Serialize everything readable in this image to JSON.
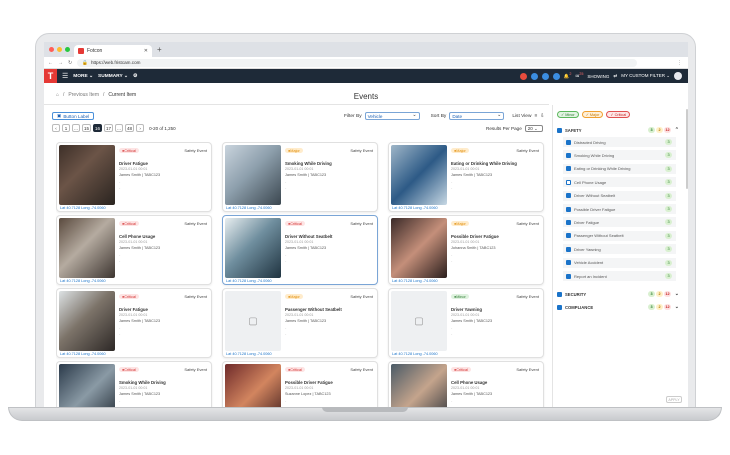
{
  "browser": {
    "tab_title": "Fotcon",
    "url": "https://web.fristcam.com"
  },
  "header": {
    "logo": "T",
    "more_label": "MORE",
    "summary_label": "SUMMARY",
    "showing_label": "SHOWING",
    "filter_label": "MY CUSTOM FILTER",
    "badges": [
      "2",
      "25"
    ]
  },
  "breadcrumb": {
    "previous": "Previous Item",
    "current": "Current Item"
  },
  "page": {
    "title": "Events"
  },
  "toolbar": {
    "button_label": "Button Label",
    "pages": [
      "‹",
      "1",
      "...",
      "15",
      "16",
      "17",
      "...",
      "48",
      "›"
    ],
    "active_page": "16",
    "range": "0-20 of 1,250",
    "filter_by_label": "Filter By",
    "filter_by_value": "Vehicle",
    "sort_by_label": "Sort By",
    "sort_by_value": "Date",
    "list_view_label": "List View",
    "rpp_label": "Results Per Page",
    "rpp_value": "20"
  },
  "events": [
    {
      "severity": "Critical",
      "type": "Safety Event",
      "name": "Driver Fatigue",
      "date": "2023-01-01 00:01",
      "driver": "James Smith | TABC123",
      "loc": "Lat 40.7128 Long -74.0060",
      "photo": "p1"
    },
    {
      "severity": "Major",
      "type": "Safety Event",
      "name": "Smoking While Driving",
      "date": "2023-01-01 00:01",
      "driver": "James Smith | TABC123",
      "loc": "Lat 40.7128 Long -74.0060",
      "photo": "p2"
    },
    {
      "severity": "Major",
      "type": "Safety Event",
      "name": "Eating or Drinking While Driving",
      "date": "2023-01-01 00:01",
      "driver": "James Smith | TABC123",
      "loc": "Lat 40.7128 Long -74.0060",
      "photo": "p3"
    },
    {
      "severity": "Critical",
      "type": "Safety Event",
      "name": "Cell Phone Usage",
      "date": "2023-01-01 00:01",
      "driver": "James Smith | TABC123",
      "loc": "Lat 40.7128 Long -74.0060",
      "photo": "p4"
    },
    {
      "severity": "Critical",
      "type": "Safety Event",
      "name": "Driver Without Seatbelt",
      "date": "2023-01-01 00:01",
      "driver": "James Smith | TABC123",
      "loc": "Lat 40.7128 Long -74.0060",
      "photo": "p5"
    },
    {
      "severity": "Major",
      "type": "Safety Event",
      "name": "Possible Driver Fatigue",
      "date": "2023-01-01 00:01",
      "driver": "Johanna Smith | TABC123",
      "loc": "Lat 40.7128 Long -74.0060",
      "photo": "p6"
    },
    {
      "severity": "Critical",
      "type": "Safety Event",
      "name": "Driver Fatigue",
      "date": "2023-01-01 00:01",
      "driver": "James Smith | TABC123",
      "loc": "Lat 40.7128 Long -74.0060",
      "photo": "p7"
    },
    {
      "severity": "Major",
      "type": "Safety Event",
      "name": "Passenger Without Seatbelt",
      "date": "2023-01-01 00:01",
      "driver": "James Smith | TABC123",
      "loc": "Lat 40.7128 Long -74.0060",
      "photo": ""
    },
    {
      "severity": "Minor",
      "type": "Safety Event",
      "name": "Driver Yawning",
      "date": "2023-01-01 00:01",
      "driver": "James Smith | TABC123",
      "loc": "Lat 40.7128 Long -74.0060",
      "photo": ""
    },
    {
      "severity": "Critical",
      "type": "Safety Event",
      "name": "Smoking While Driving",
      "date": "2023-01-01 00:01",
      "driver": "James Smith | TABC123",
      "loc": "",
      "photo": "p10"
    },
    {
      "severity": "Critical",
      "type": "Safety Event",
      "name": "Possible Driver Fatigue",
      "date": "2023-01-01 00:01",
      "driver": "Suzanne Lopez | TABC123",
      "loc": "",
      "photo": "p11"
    },
    {
      "severity": "Critical",
      "type": "Safety Event",
      "name": "Cell Phone Usage",
      "date": "2023-01-01 00:01",
      "driver": "James Smith | TABC123",
      "loc": "",
      "photo": "p12"
    }
  ],
  "filters": {
    "chips": [
      {
        "label": "Minor",
        "cls": "Minor"
      },
      {
        "label": "Major",
        "cls": "Major"
      },
      {
        "label": "Critical",
        "cls": "Critical"
      }
    ],
    "safety": {
      "label": "SAFETY",
      "counts": [
        "3",
        "2",
        "12"
      ],
      "items": [
        {
          "label": "Distracted Driving",
          "count": "3",
          "checked": true
        },
        {
          "label": "Smoking While Driving",
          "count": "3",
          "checked": true
        },
        {
          "label": "Eating or Drinking While Driving",
          "count": "3",
          "checked": true
        },
        {
          "label": "Cell Phone Usage",
          "count": "3",
          "checked": false
        },
        {
          "label": "Driver Without Seatbelt",
          "count": "3",
          "checked": true
        },
        {
          "label": "Possible Driver Fatigue",
          "count": "3",
          "checked": true
        },
        {
          "label": "Driver Fatigue",
          "count": "3",
          "checked": true
        },
        {
          "label": "Passenger Without Seatbelt",
          "count": "3",
          "checked": true
        },
        {
          "label": "Driver Yawning",
          "count": "3",
          "checked": true
        },
        {
          "label": "Vehicle Accident",
          "count": "3",
          "checked": true
        },
        {
          "label": "Report an Incident",
          "count": "3",
          "checked": true
        }
      ]
    },
    "security": {
      "label": "SECURITY",
      "counts": [
        "3",
        "2",
        "12"
      ]
    },
    "compliance": {
      "label": "COMPLIANCE",
      "counts": [
        "3",
        "2",
        "12"
      ]
    },
    "apply_label": "APPLY"
  }
}
